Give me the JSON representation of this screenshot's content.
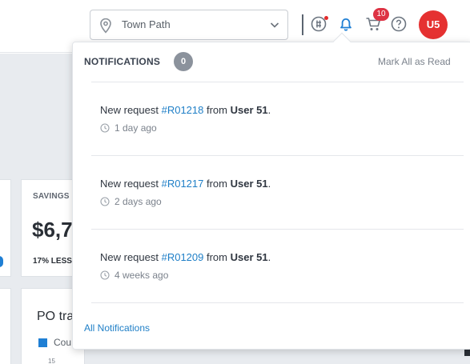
{
  "header": {
    "location": {
      "value": "Town Path",
      "icon": "map-pin-icon"
    },
    "icons": [
      "currency-icon",
      "bell-icon",
      "cart-icon",
      "help-icon"
    ],
    "cart_badge": "10",
    "avatar_initials": "U5",
    "colors": {
      "avatar": "#e53131",
      "badge": "#dd3344"
    }
  },
  "dashboard": {
    "savings_label": "SAVINGS",
    "savings_value": "$6,7",
    "savings_sub": "17% LESS",
    "po_title": "PO tra",
    "po_legend": "Cou",
    "po_tick": "15"
  },
  "notifications": {
    "title": "NOTIFICATIONS",
    "count": "0",
    "mark_all": "Mark All as Read",
    "items": [
      {
        "prefix": "New request ",
        "request": "#R01218",
        "mid": " from ",
        "user": "User 51",
        "suffix": ".",
        "time": "1 day ago"
      },
      {
        "prefix": "New request ",
        "request": "#R01217",
        "mid": " from ",
        "user": "User 51",
        "suffix": ".",
        "time": "2 days ago"
      },
      {
        "prefix": "New request ",
        "request": "#R01209",
        "mid": " from ",
        "user": "User 51",
        "suffix": ".",
        "time": "4 weeks ago"
      }
    ],
    "all_link": "All Notifications",
    "link_color": "#1f7fc7"
  }
}
